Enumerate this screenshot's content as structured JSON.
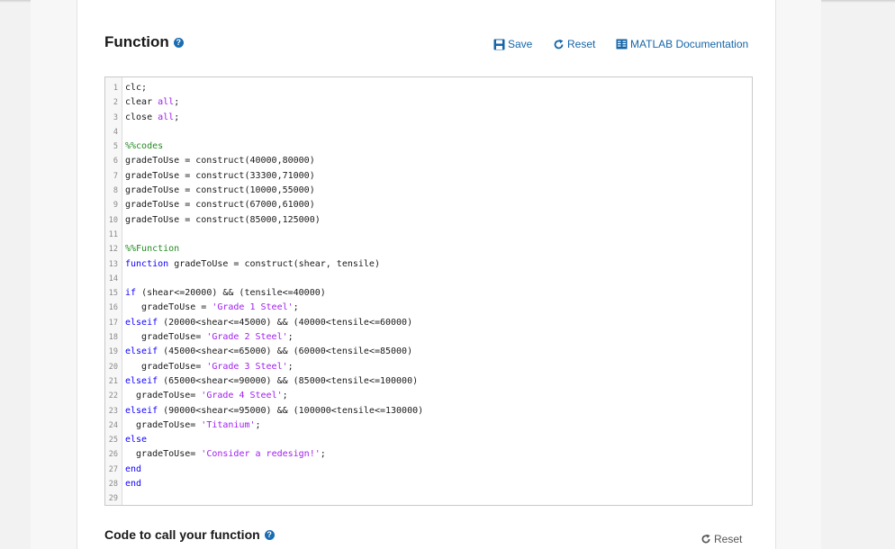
{
  "function_section": {
    "title": "Function",
    "help_icon": "question-circle-icon",
    "toolbar": {
      "save_label": "Save",
      "reset_label": "Reset",
      "docs_label": "MATLAB Documentation"
    }
  },
  "editor": {
    "lines": [
      [
        {
          "t": "clc;",
          "c": ""
        }
      ],
      [
        {
          "t": "clear ",
          "c": ""
        },
        {
          "t": "all",
          "c": "str"
        },
        {
          "t": ";",
          "c": ""
        }
      ],
      [
        {
          "t": "close ",
          "c": ""
        },
        {
          "t": "all",
          "c": "str"
        },
        {
          "t": ";",
          "c": ""
        }
      ],
      [
        {
          "t": "",
          "c": ""
        }
      ],
      [
        {
          "t": "%%codes",
          "c": "cm"
        }
      ],
      [
        {
          "t": "gradeToUse = construct(40000,80000)",
          "c": ""
        }
      ],
      [
        {
          "t": "gradeToUse = construct(33300,71000)",
          "c": ""
        }
      ],
      [
        {
          "t": "gradeToUse = construct(10000,55000)",
          "c": ""
        }
      ],
      [
        {
          "t": "gradeToUse = construct(67000,61000)",
          "c": ""
        }
      ],
      [
        {
          "t": "gradeToUse = construct(85000,125000)",
          "c": ""
        }
      ],
      [
        {
          "t": "",
          "c": ""
        }
      ],
      [
        {
          "t": "%%Function",
          "c": "cm"
        }
      ],
      [
        {
          "t": "function",
          "c": "kw"
        },
        {
          "t": " gradeToUse = construct(shear, tensile)",
          "c": ""
        }
      ],
      [
        {
          "t": "",
          "c": ""
        }
      ],
      [
        {
          "t": "if",
          "c": "kw"
        },
        {
          "t": " (shear<=20000) && (tensile<=40000)",
          "c": ""
        }
      ],
      [
        {
          "t": "   gradeToUse = ",
          "c": ""
        },
        {
          "t": "'Grade 1 Steel'",
          "c": "str"
        },
        {
          "t": ";",
          "c": ""
        }
      ],
      [
        {
          "t": "elseif",
          "c": "kw"
        },
        {
          "t": " (20000<shear<=45000) && (40000<tensile<=60000)",
          "c": ""
        }
      ],
      [
        {
          "t": "   gradeToUse= ",
          "c": ""
        },
        {
          "t": "'Grade 2 Steel'",
          "c": "str"
        },
        {
          "t": ";",
          "c": ""
        }
      ],
      [
        {
          "t": "elseif",
          "c": "kw"
        },
        {
          "t": " (45000<shear<=65000) && (60000<tensile<=85000)",
          "c": ""
        }
      ],
      [
        {
          "t": "   gradeToUse= ",
          "c": ""
        },
        {
          "t": "'Grade 3 Steel'",
          "c": "str"
        },
        {
          "t": ";",
          "c": ""
        }
      ],
      [
        {
          "t": "elseif",
          "c": "kw"
        },
        {
          "t": " (65000<shear<=90000) && (85000<tensile<=100000)",
          "c": ""
        }
      ],
      [
        {
          "t": "  gradeToUse= ",
          "c": ""
        },
        {
          "t": "'Grade 4 Steel'",
          "c": "str"
        },
        {
          "t": ";",
          "c": ""
        }
      ],
      [
        {
          "t": "elseif",
          "c": "kw"
        },
        {
          "t": " (90000<shear<=95000) && (100000<tensile<=130000)",
          "c": ""
        }
      ],
      [
        {
          "t": "  gradeToUse= ",
          "c": ""
        },
        {
          "t": "'Titanium'",
          "c": "str"
        },
        {
          "t": ";",
          "c": ""
        }
      ],
      [
        {
          "t": "else",
          "c": "kw"
        }
      ],
      [
        {
          "t": "  gradeToUse= ",
          "c": ""
        },
        {
          "t": "'Consider a redesign!'",
          "c": "str"
        },
        {
          "t": ";",
          "c": ""
        }
      ],
      [
        {
          "t": "end",
          "c": "kw"
        }
      ],
      [
        {
          "t": "end",
          "c": "kw"
        }
      ],
      [
        {
          "t": "",
          "c": ""
        }
      ]
    ]
  },
  "call_section": {
    "title": "Code to call your function",
    "reset_label": "Reset"
  },
  "colors": {
    "link": "#1565a8",
    "keyword": "#0e00ff",
    "comment": "#228b22",
    "string": "#a020f0"
  }
}
